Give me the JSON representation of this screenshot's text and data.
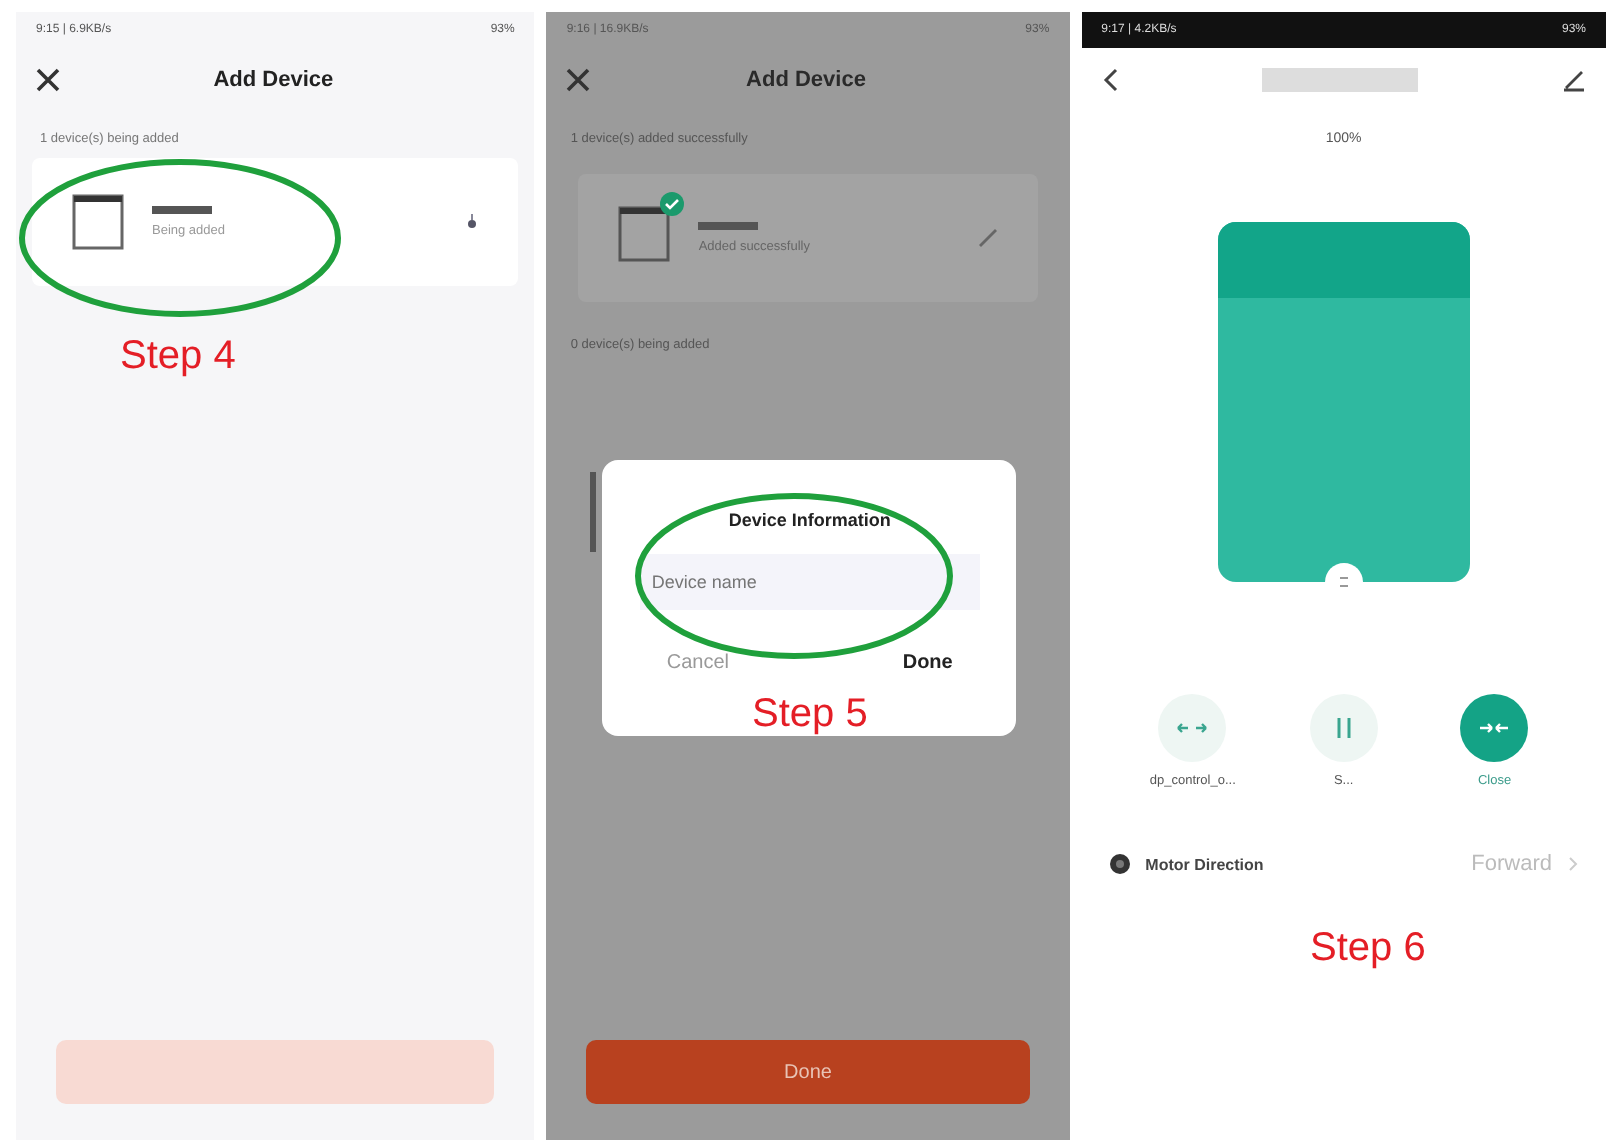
{
  "step4_screen": {
    "status_time": "9:15 | 6.9KB/s",
    "battery": "93%",
    "title": "Add Device",
    "section": "1 device(s) being added",
    "device_status": "Being added",
    "done_button": {
      "disabled": true
    }
  },
  "step5_screen": {
    "status_time": "9:16 | 16.9KB/s",
    "battery": "93%",
    "title": "Add Device",
    "added_section": "1 device(s) added successfully",
    "device_status": "Added successfully",
    "pending_section": "0 device(s) being added",
    "dialog": {
      "title": "Device Information",
      "placeholder": "Device name",
      "cancel": "Cancel",
      "confirm": "Done"
    },
    "done_button": {
      "label": "Done",
      "disabled": false
    }
  },
  "step6_screen": {
    "status_time": "9:17 | 4.2KB/s",
    "battery": "93%",
    "percent": "100%",
    "controls": [
      {
        "kind": "open",
        "label": "dp_control_o...",
        "selected": false
      },
      {
        "kind": "pause",
        "label": "S...",
        "selected": false
      },
      {
        "kind": "close",
        "label": "Close",
        "selected": true
      }
    ],
    "setting": {
      "label": "Motor Direction",
      "value": "Forward"
    }
  },
  "annotations": [
    {
      "label": "Step 4"
    },
    {
      "label": "Step 5"
    },
    {
      "label": "Step 6"
    }
  ]
}
